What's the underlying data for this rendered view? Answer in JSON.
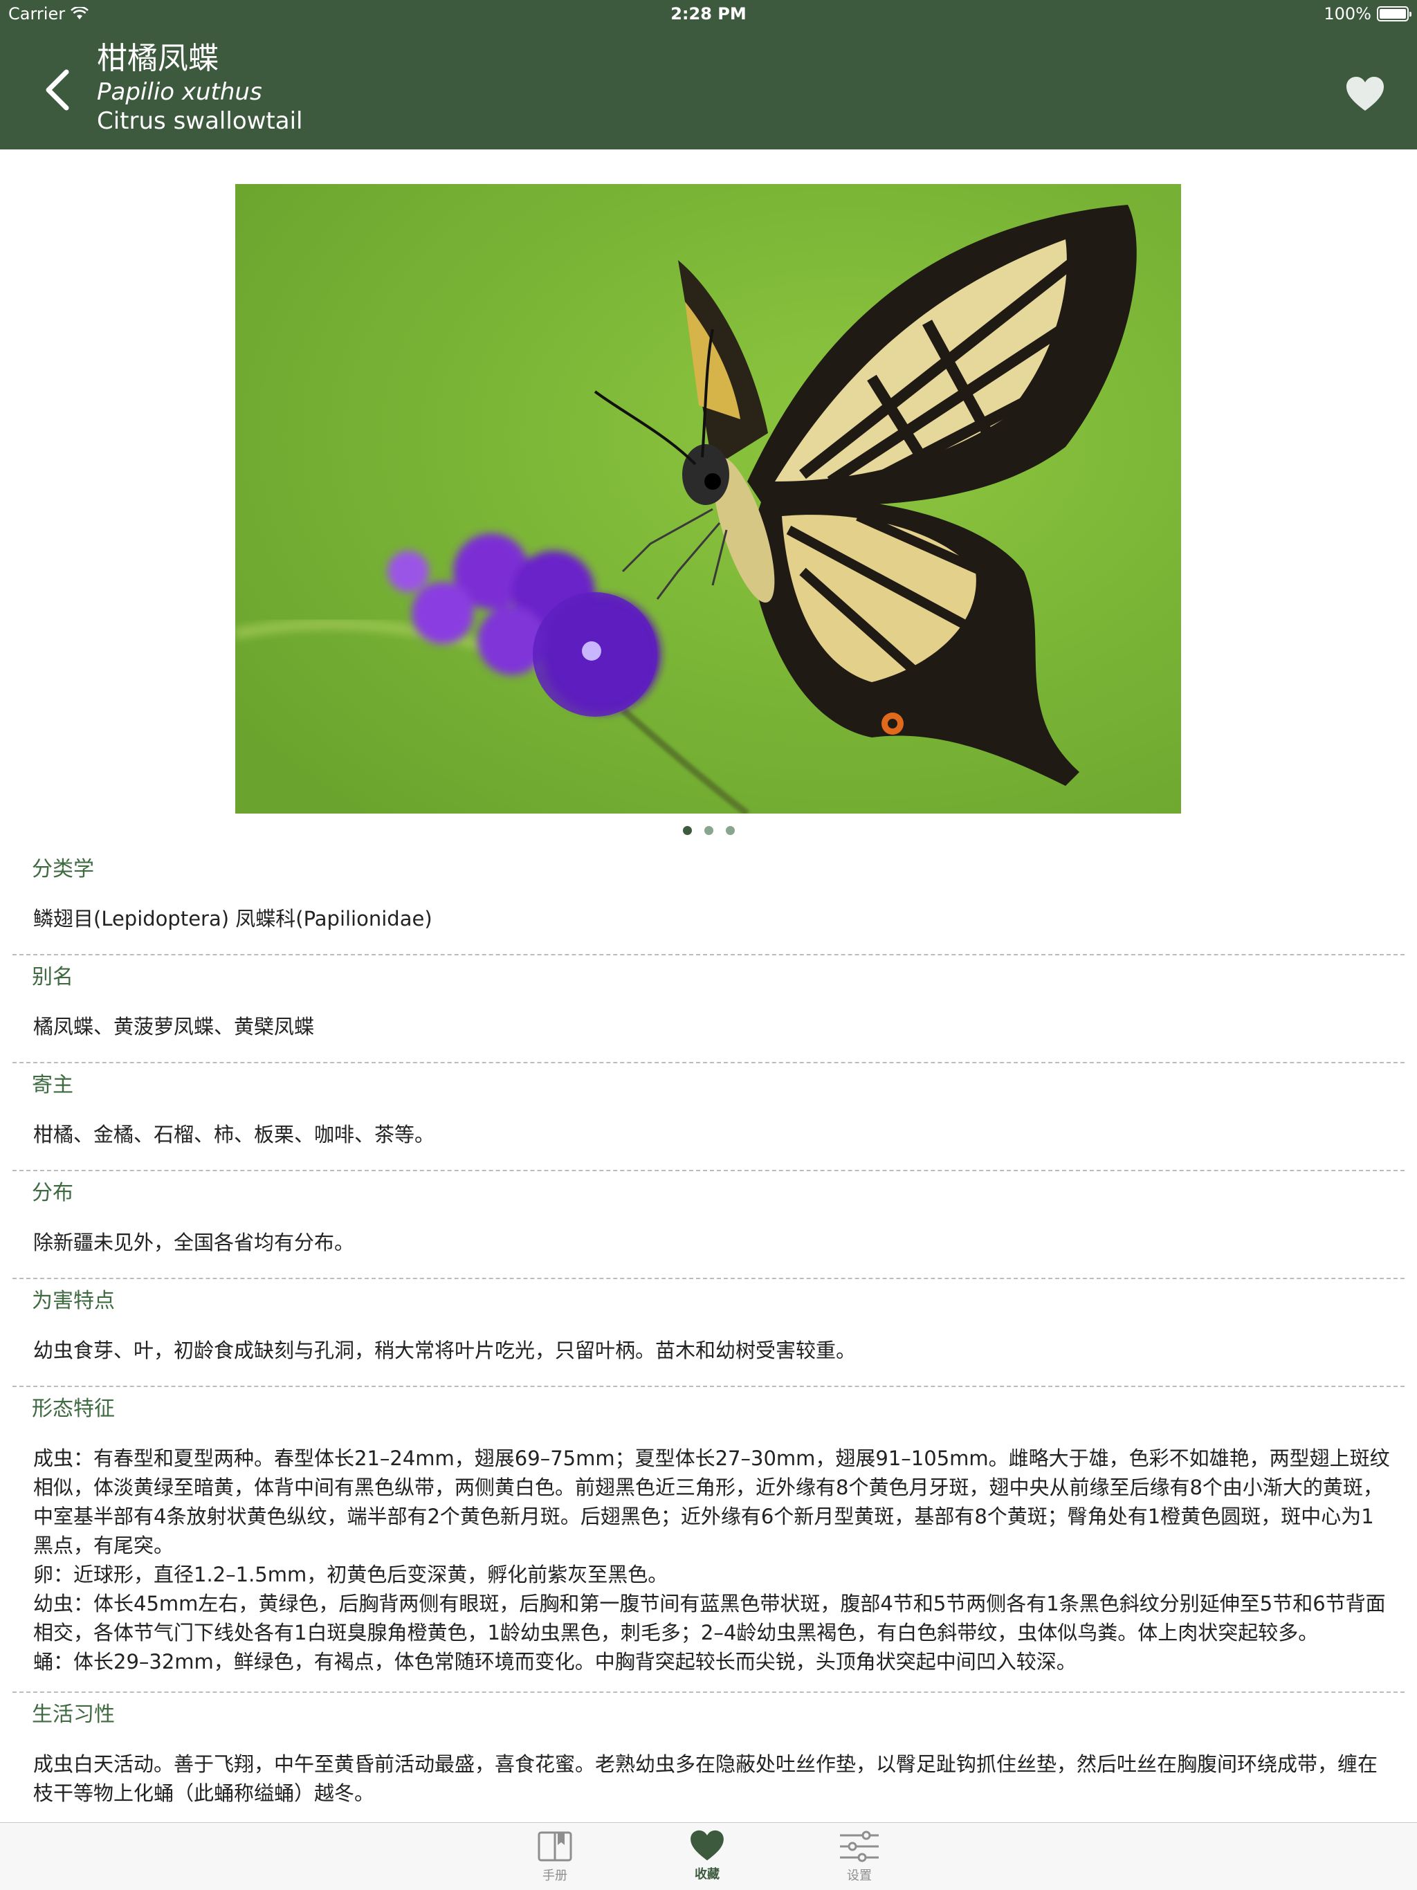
{
  "status_bar": {
    "carrier": "Carrier",
    "time": "2:28 PM",
    "battery": "100%"
  },
  "header": {
    "title_cn": "柑橘凤蝶",
    "title_latin": "Papilio xuthus",
    "title_en": "Citrus swallowtail",
    "back_icon": "chevron-left-icon",
    "favorite_icon": "heart-icon"
  },
  "gallery": {
    "image_alt": "Swallowtail butterfly on purple flowers",
    "page_count": 3,
    "current_page": 1
  },
  "sections": [
    {
      "label": "分类学",
      "text": "鳞翅目(Lepidoptera) 凤蝶科(Papilionidae)"
    },
    {
      "label": "别名",
      "text": "橘凤蝶、黄菠萝凤蝶、黄檗凤蝶"
    },
    {
      "label": "寄主",
      "text": "柑橘、金橘、石榴、柿、板栗、咖啡、茶等。"
    },
    {
      "label": "分布",
      "text": "除新疆未见外，全国各省均有分布。"
    },
    {
      "label": "为害特点",
      "text": "幼虫食芽、叶，初龄食成缺刻与孔洞，稍大常将叶片吃光，只留叶柄。苗木和幼树受害较重。"
    },
    {
      "label": "形态特征",
      "text": "成虫：有春型和夏型两种。春型体长21–24mm，翅展69–75mm；夏型体长27–30mm，翅展91–105mm。雌略大于雄，色彩不如雄艳，两型翅上斑纹相似，体淡黄绿至暗黄，体背中间有黑色纵带，两侧黄白色。前翅黑色近三角形，近外缘有8个黄色月牙斑，翅中央从前缘至后缘有8个由小渐大的黄斑，中室基半部有4条放射状黄色纵纹，端半部有2个黄色新月斑。后翅黑色；近外缘有6个新月型黄斑，基部有8个黄斑；臀角处有1橙黄色圆斑，斑中心为1黑点，有尾突。\n卵：近球形，直径1.2–1.5mm，初黄色后变深黄，孵化前紫灰至黑色。\n幼虫：体长45mm左右，黄绿色，后胸背两侧有眼斑，后胸和第一腹节间有蓝黑色带状斑，腹部4节和5节两侧各有1条黑色斜纹分别延伸至5节和6节背面相交，各体节气门下线处各有1白斑臭腺角橙黄色，1龄幼虫黑色，刺毛多；2–4龄幼虫黑褐色，有白色斜带纹，虫体似鸟粪。体上肉状突起较多。\n蛹：体长29–32mm，鲜绿色，有褐点，体色常随环境而变化。中胸背突起较长而尖锐，头顶角状突起中间凹入较深。"
    },
    {
      "label": "生活习性",
      "text": "成虫白天活动。善于飞翔，中午至黄昏前活动最盛，喜食花蜜。老熟幼虫多在隐蔽处吐丝作垫，以臀足趾钩抓住丝垫，然后吐丝在胸腹间环绕成带，缠在枝干等物上化蛹（此蛹称缢蛹）越冬。"
    }
  ],
  "tabbar": {
    "tabs": [
      {
        "label": "手册",
        "icon": "book-icon"
      },
      {
        "label": "收藏",
        "icon": "heart-icon"
      },
      {
        "label": "设置",
        "icon": "sliders-icon"
      }
    ],
    "active_index": 1
  },
  "colors": {
    "header_bg": "#3d5a3e",
    "section_label": "#3e6a40",
    "tab_active": "#3d5a3e",
    "tab_inactive": "#8e8e8e"
  }
}
